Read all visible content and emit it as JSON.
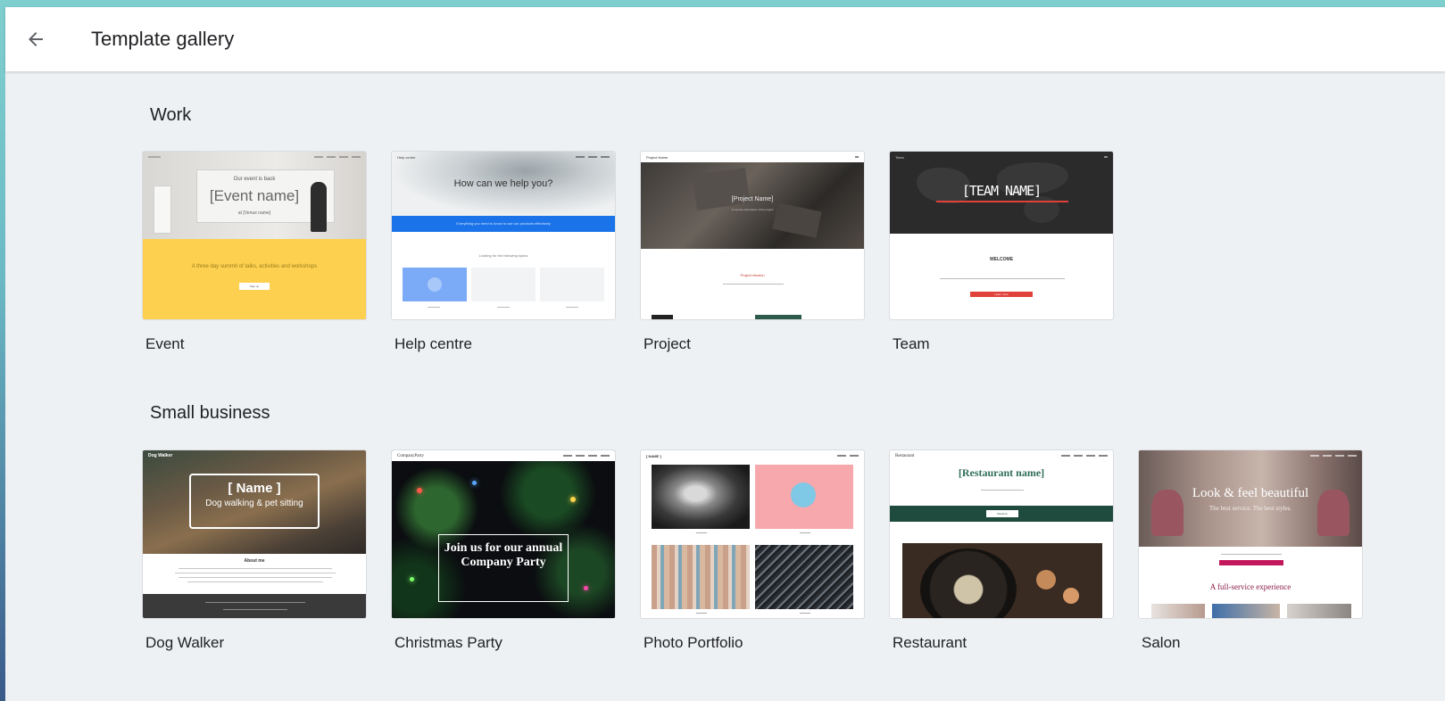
{
  "header": {
    "title": "Template gallery"
  },
  "sections": [
    {
      "title": "Work",
      "templates": [
        {
          "label": "Event",
          "preview": {
            "heading": "[Event name]",
            "kicker": "Our event is back",
            "sub": "at [Venue name]",
            "banner": "A three day summit of talks, activities and workshops",
            "button": "Sign up"
          }
        },
        {
          "label": "Help centre",
          "preview": {
            "heading": "How can we help you?",
            "brand": "Help centre",
            "strip": "Everything you need to know to use our products effectively",
            "sub": "Looking for the following topics"
          }
        },
        {
          "label": "Project",
          "preview": {
            "brand": "Project Name",
            "heading": "[Project Name]",
            "sub": "A one-line description of the project",
            "mission": "Project mission"
          }
        },
        {
          "label": "Team",
          "preview": {
            "brand": "Team",
            "heading": "[TEAM NAME]",
            "welcome": "WELCOME",
            "button": "Learn more"
          }
        }
      ]
    },
    {
      "title": "Small business",
      "templates": [
        {
          "label": "Dog Walker",
          "preview": {
            "brand": "Dog Walker",
            "heading": "[ Name ]",
            "sub": "Dog walking & pet sitting",
            "about": "About me"
          }
        },
        {
          "label": "Christmas Party",
          "preview": {
            "brand": "CompanyParty",
            "heading": "Join us for our annual Company Party"
          }
        },
        {
          "label": "Photo Portfolio",
          "preview": {
            "brand": "[ NAME ]"
          }
        },
        {
          "label": "Restaurant",
          "preview": {
            "brand": "Restaurant",
            "heading": "[Restaurant name]",
            "button": "Reserve"
          }
        },
        {
          "label": "Salon",
          "preview": {
            "heading": "Look & feel beautiful",
            "sub": "The best service. The best styles.",
            "tagline": "A full-service experience"
          }
        }
      ]
    }
  ],
  "colors": {
    "event_yellow": "#fdd04f",
    "help_blue": "#1a73e8",
    "team_red": "#e0413a",
    "restaurant_green": "#1f4a3e",
    "salon_pink": "#c2185b",
    "restaurant_heading": "#2f6e5a"
  }
}
